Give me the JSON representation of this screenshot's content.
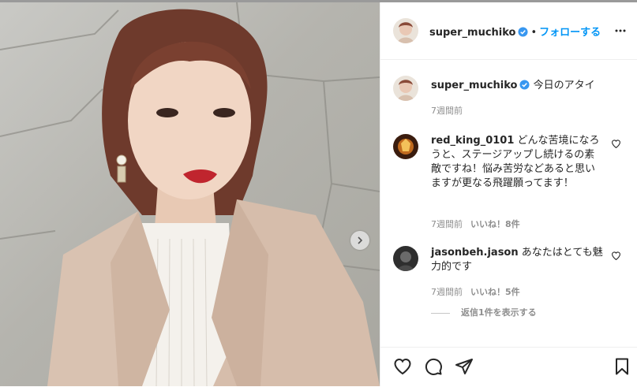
{
  "header": {
    "username": "super_muchiko",
    "separator": "•",
    "follow_label": "フォローする",
    "more_icon": "more-horizontal-icon"
  },
  "caption": {
    "username": "super_muchiko",
    "text": "今日のアタイ",
    "time": "7週間前"
  },
  "comments": [
    {
      "username": "red_king_0101",
      "text": "どんな苦境になろうと、ステージアップし続けるの素敵ですね！悩み苦労などあると思いますが更なる飛躍願ってます！",
      "time": "7週間前",
      "likes": "いいね！8件"
    },
    {
      "username": "jasonbeh.jason",
      "text": "あなたはとても魅力的です",
      "time": "7週間前",
      "likes": "いいね！5件"
    }
  ],
  "view_replies": "返信1件を表示する",
  "colors": {
    "accent": "#0095f6",
    "verified": "#3897f0",
    "text": "#262626",
    "muted": "#8e8e8e"
  },
  "icons": [
    "heart-icon",
    "comment-icon",
    "share-icon",
    "bookmark-icon",
    "verified-badge-icon",
    "chevron-right-icon"
  ]
}
